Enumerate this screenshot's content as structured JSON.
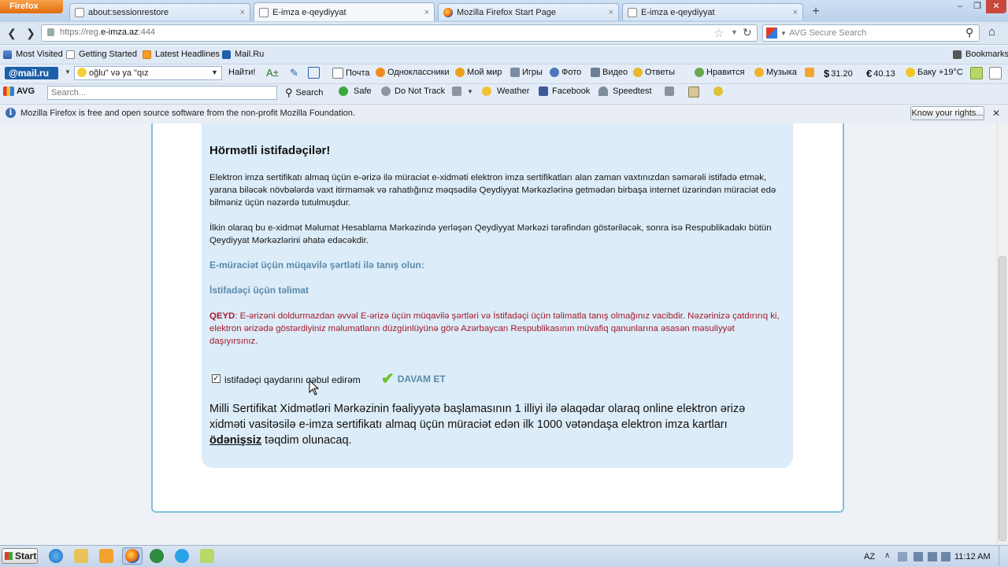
{
  "browser": {
    "app_button": "Firefox",
    "tabs": [
      {
        "label": "about:sessionrestore",
        "icon": "blank-page-icon",
        "active": false
      },
      {
        "label": "E-imza e-qeydiyyat",
        "icon": "blank-page-icon",
        "active": true
      },
      {
        "label": "Mozilla Firefox Start Page",
        "icon": "firefox-icon",
        "active": false
      },
      {
        "label": "E-imza e-qeydiyyat",
        "icon": "blank-page-icon",
        "active": false
      }
    ],
    "new_tab": "+",
    "close_symbol": "×",
    "url_prefix": "https://reg.",
    "url_domain": "e-imza.az",
    "url_port": ":444",
    "search_placeholder": "AVG Secure Search"
  },
  "bookmarks": {
    "items": [
      "Most Visited",
      "Getting Started",
      "Latest Headlines",
      "Mail.Ru"
    ],
    "right": "Bookmarks"
  },
  "mailru_toolbar": {
    "logo": "@mail.ru",
    "search_value": "oğlu\" və ya \"qız",
    "find_button": "Найти!",
    "items": [
      "Почта",
      "Одноклассники",
      "Мой мир",
      "Игры",
      "Фото",
      "Видео",
      "Ответы",
      "Нравится",
      "Музыка"
    ],
    "usd": "31.20",
    "eur": "40.13",
    "weather": "Баку +19°C"
  },
  "avg_toolbar": {
    "logo": "AVG",
    "search_placeholder": "Search...",
    "items": [
      "Search",
      "Safe",
      "Do Not Track",
      "Weather",
      "Facebook",
      "Speedtest"
    ]
  },
  "notification": {
    "text": "Mozilla Firefox is free and open source software from the non-profit Mozilla Foundation.",
    "button": "Know your rights..."
  },
  "page": {
    "heading": "Hörmətli istifadəçilər!",
    "para1": "Elektron imza sertifikatı almaq üçün e-ərizə ilə müraciət e-xidməti elektron imza sertifikatları alan zaman vaxtınızdan səmərəli istifadə etmək, yarana biləcək növbələrdə vaxt itirməmək və rahatlığınız məqsədilə Qeydiyyat Mərkəzlərinə getmədən birbaşa internet üzərindən müraciət edə bilməniz üçün nəzərdə tutulmuşdur.",
    "para2": "İlkin olaraq bu e-xidmət Məlumat Hesablama Mərkəzində yerləşən Qeydiyyat Mərkəzi tərəfindən göstəriləcək, sonra isə Respublikadakı bütün Qeydiyyat Mərkəzlərini əhatə edəcəkdir.",
    "link1": "E-müraciət üçün müqavilə şərtləti ilə tanış olun:",
    "link2": "İstifadəçi üçün təlimat",
    "note_label": "QEYD",
    "note_text": ": E-ərizəni doldurmazdan əvvəl E-ərizə üçün müqavilə şərtləri və İstifadəçi üçün təlimatla tanış olmağınız vacibdir. Nəzərinizə çatdırırıq ki, elektron ərizədə göstərdiyiniz məlumatların düzgünlüyünə görə Azərbaycan Respublikasının müvafiq qanunlarına əsasən məsuliyyət daşıyırsınız.",
    "checkbox_label": "istifadəçi qaydarını qəbul edirəm",
    "checkbox_checked": true,
    "continue_button": "DAVAM ET",
    "big_text": "Milli Sertifikat Xidmətləri Mərkəzinin fəaliyyətə başlamasının 1 illiyi ilə əlaqədar olaraq online elektron ərizə xidməti vasitəsilə e-imza sertifikatı almaq üçün müraciət edən ilk 1000 vətəndaşa elektron imza kartları",
    "big_bold": "ödənişsiz",
    "big_end": " təqdim olunacaq."
  },
  "taskbar": {
    "start": "Start",
    "lang": "AZ",
    "time": "11:12 AM"
  }
}
